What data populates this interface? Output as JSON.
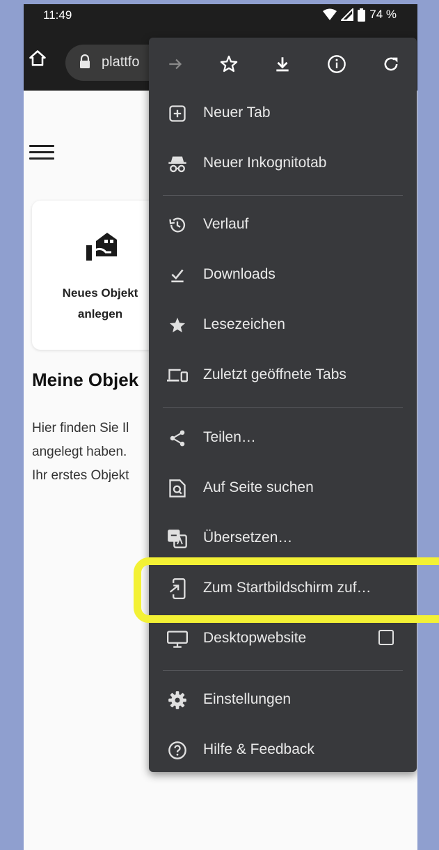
{
  "status_bar": {
    "time": "11:49",
    "battery": "74 %"
  },
  "browser": {
    "url": "plattfo"
  },
  "page": {
    "card_label_line1": "Neues Objekt",
    "card_label_line2": "anlegen",
    "section_title": "Meine Objek",
    "section_text": [
      "Hier finden Sie Il",
      "angelegt haben.",
      "Ihr erstes Objekt"
    ]
  },
  "menu": {
    "toolbar": [
      "forward-icon",
      "star-icon",
      "download-icon",
      "info-icon",
      "refresh-icon"
    ],
    "items": [
      {
        "label": "Neuer Tab",
        "icon": "new-tab-icon"
      },
      {
        "label": "Neuer Inkognitotab",
        "icon": "incognito-icon"
      },
      {
        "label": "Verlauf",
        "icon": "history-icon"
      },
      {
        "label": "Downloads",
        "icon": "downloads-icon"
      },
      {
        "label": "Lesezeichen",
        "icon": "bookmark-star-icon"
      },
      {
        "label": "Zuletzt geöffnete Tabs",
        "icon": "devices-icon"
      },
      {
        "label": "Teilen…",
        "icon": "share-icon"
      },
      {
        "label": "Auf Seite suchen",
        "icon": "find-in-page-icon"
      },
      {
        "label": "Übersetzen…",
        "icon": "translate-icon"
      },
      {
        "label": "Zum Startbildschirm zuf…",
        "icon": "add-to-home-icon"
      },
      {
        "label": "Desktopwebsite",
        "icon": "desktop-icon"
      },
      {
        "label": "Einstellungen",
        "icon": "settings-gear-icon"
      },
      {
        "label": "Hilfe & Feedback",
        "icon": "help-icon"
      }
    ]
  },
  "colors": {
    "highlight": "#f3f135",
    "menu_bg": "#38393c",
    "bar_bg": "#1e1e1e"
  }
}
